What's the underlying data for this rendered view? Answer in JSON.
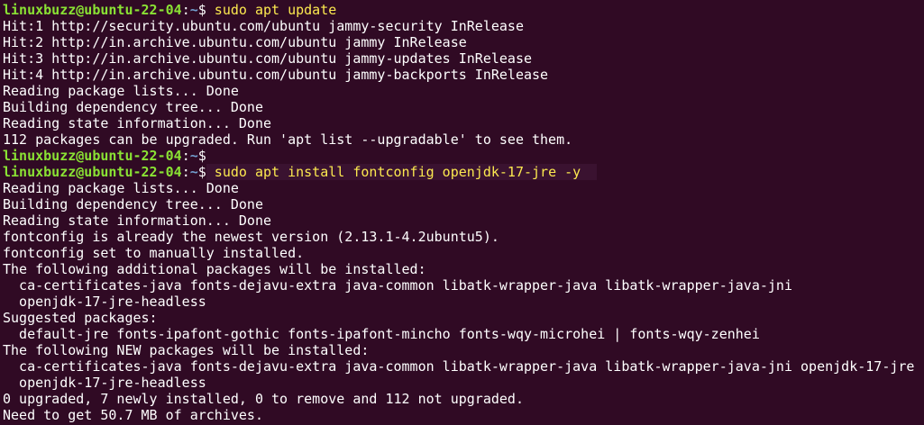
{
  "prompt": {
    "user_host": "linuxbuzz@ubuntu-22-04",
    "separator": ":",
    "path": "~",
    "symbol": "$"
  },
  "commands": {
    "first": " sudo apt update",
    "second": "",
    "third": " sudo apt install fontconfig openjdk-17-jre -y"
  },
  "output_block_1": [
    "Hit:1 http://security.ubuntu.com/ubuntu jammy-security InRelease",
    "Hit:2 http://in.archive.ubuntu.com/ubuntu jammy InRelease",
    "Hit:3 http://in.archive.ubuntu.com/ubuntu jammy-updates InRelease",
    "Hit:4 http://in.archive.ubuntu.com/ubuntu jammy-backports InRelease",
    "Reading package lists... Done",
    "Building dependency tree... Done",
    "Reading state information... Done",
    "112 packages can be upgraded. Run 'apt list --upgradable' to see them."
  ],
  "output_block_2": [
    "Reading package lists... Done",
    "Building dependency tree... Done",
    "Reading state information... Done",
    "fontconfig is already the newest version (2.13.1-4.2ubuntu5).",
    "fontconfig set to manually installed.",
    "The following additional packages will be installed:",
    "  ca-certificates-java fonts-dejavu-extra java-common libatk-wrapper-java libatk-wrapper-java-jni",
    "  openjdk-17-jre-headless",
    "Suggested packages:",
    "  default-jre fonts-ipafont-gothic fonts-ipafont-mincho fonts-wqy-microhei | fonts-wqy-zenhei",
    "The following NEW packages will be installed:",
    "  ca-certificates-java fonts-dejavu-extra java-common libatk-wrapper-java libatk-wrapper-java-jni openjdk-17-jre",
    "  openjdk-17-jre-headless",
    "0 upgraded, 7 newly installed, 0 to remove and 112 not upgraded.",
    "Need to get 50.7 MB of archives."
  ],
  "colors": {
    "background": "#300a24",
    "prompt_user": "#8ae234",
    "prompt_path": "#729fcf",
    "command_text": "#fce94f",
    "output_text": "#ffffff"
  }
}
